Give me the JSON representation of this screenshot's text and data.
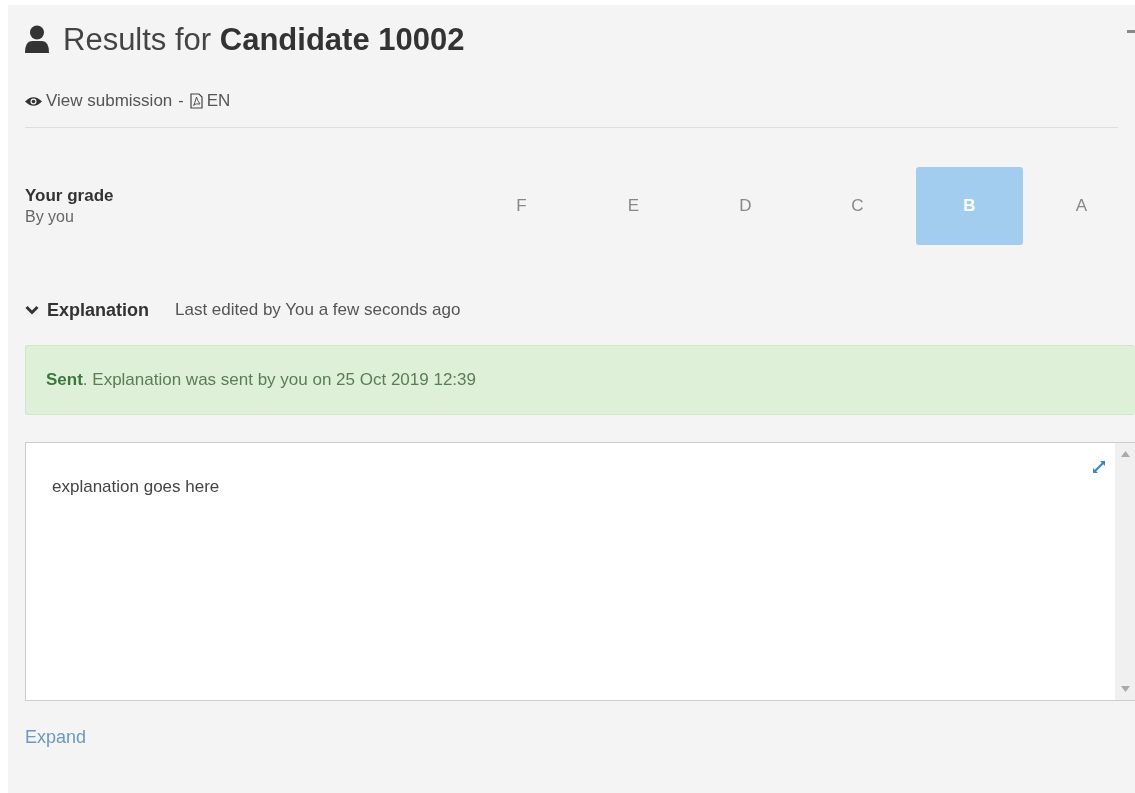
{
  "header": {
    "title": "Results for **Candidate 10002**",
    "view_link": "View submission",
    "separator": "-",
    "language_link": "EN"
  },
  "grade": {
    "label": "Your grade",
    "sublabel": "By you",
    "options": [
      {
        "label": "F",
        "selected": false
      },
      {
        "label": "E",
        "selected": false
      },
      {
        "label": "D",
        "selected": false
      },
      {
        "label": "C",
        "selected": false
      },
      {
        "label": "B",
        "selected": true
      },
      {
        "label": "A",
        "selected": false
      }
    ]
  },
  "explanation": {
    "expanded": true,
    "title": "Explanation",
    "meta": "Last edited by You a few seconds ago",
    "alert": "**Sent**. Explanation was sent by you on 25 Oct 2019 12:39",
    "text": "explanation goes here",
    "expand_link": "Expand"
  }
}
